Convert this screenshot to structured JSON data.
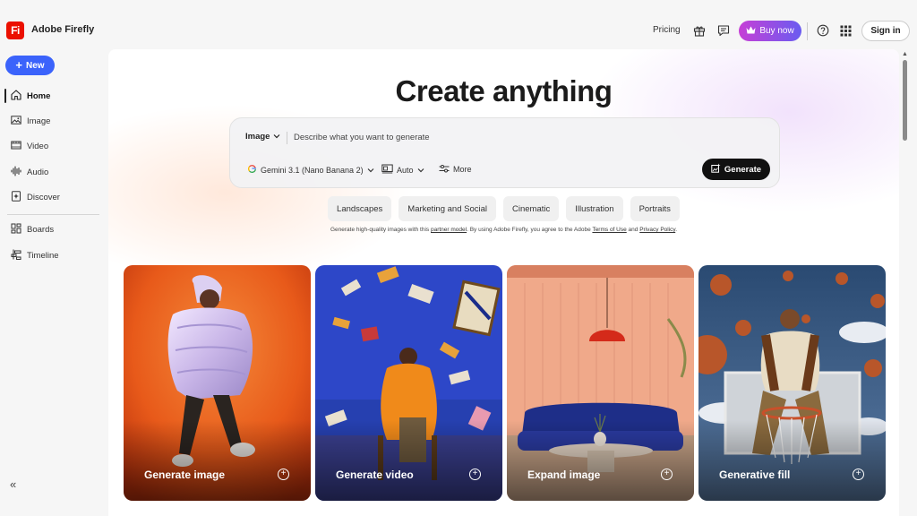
{
  "app": {
    "logo_text": "Fi",
    "title": "Adobe Firefly",
    "brand_color": "#eb1000"
  },
  "header": {
    "pricing": "Pricing",
    "buy_now": "Buy now",
    "sign_in": "Sign in",
    "icons": [
      "gift-icon",
      "feedback-icon",
      "help-icon",
      "apps-grid-icon"
    ]
  },
  "sidebar": {
    "new_label": "New",
    "items": [
      {
        "label": "Home",
        "icon": "home-icon",
        "active": true
      },
      {
        "label": "Image",
        "icon": "image-icon"
      },
      {
        "label": "Video",
        "icon": "video-icon"
      },
      {
        "label": "Audio",
        "icon": "audio-icon"
      },
      {
        "label": "Discover",
        "icon": "discover-icon"
      },
      {
        "label": "Boards",
        "icon": "boards-icon"
      },
      {
        "label": "Timeline",
        "icon": "timeline-icon"
      }
    ],
    "collapse_icon": "collapse-icon"
  },
  "main": {
    "headline": "Create anything",
    "prompt": {
      "type": "Image",
      "placeholder": "Describe what you want to generate",
      "model": "Gemini 3.1 (Nano Banana 2)",
      "aspect": "Auto",
      "more": "More",
      "generate": "Generate"
    },
    "chips": [
      "Landscapes",
      "Marketing and Social",
      "Cinematic",
      "Illustration",
      "Portraits"
    ],
    "disclaimer": {
      "prefix": "Generate high-quality images with this",
      "partner_link": "partner model",
      "middle": ". By using Adobe Firefly, you agree to the Adobe",
      "terms_link": "Terms of Use",
      "and": "and",
      "privacy_link": "Privacy Policy",
      "suffix": "."
    },
    "cards": [
      {
        "label": "Generate image"
      },
      {
        "label": "Generate video"
      },
      {
        "label": "Expand image"
      },
      {
        "label": "Generative fill"
      }
    ]
  },
  "colors": {
    "accent": "#3b63fb",
    "buy_now_start": "#c63fd6",
    "buy_now_end": "#6a5cf0"
  }
}
